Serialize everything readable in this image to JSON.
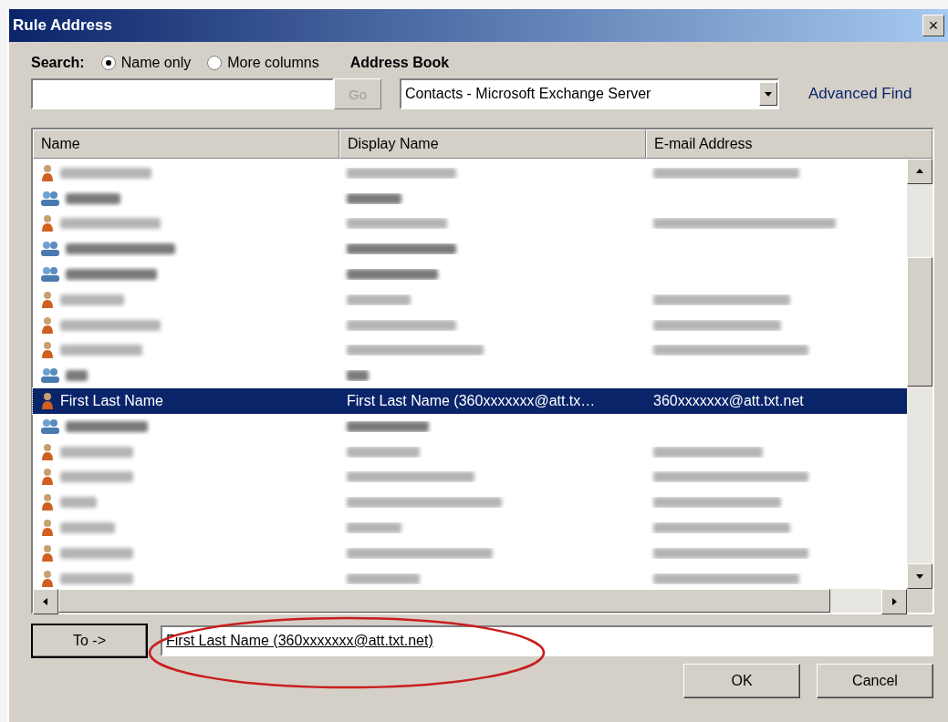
{
  "window": {
    "title": "Rule Address",
    "close": "×"
  },
  "search": {
    "label": "Search:",
    "options": [
      {
        "label": "Name only",
        "selected": true
      },
      {
        "label": "More columns",
        "selected": false
      }
    ],
    "go": "Go"
  },
  "address_book": {
    "label": "Address Book",
    "value": "Contacts - Microsoft Exchange Server"
  },
  "advanced_find": "Advanced Find",
  "table": {
    "columns": [
      "Name",
      "Display Name",
      "E-mail Address"
    ],
    "rows": [
      {
        "kind": "contact",
        "selected": false
      },
      {
        "kind": "group",
        "selected": false
      },
      {
        "kind": "contact",
        "selected": false
      },
      {
        "kind": "group",
        "selected": false
      },
      {
        "kind": "group",
        "selected": false
      },
      {
        "kind": "contact",
        "selected": false
      },
      {
        "kind": "contact",
        "selected": false
      },
      {
        "kind": "contact",
        "selected": false
      },
      {
        "kind": "group",
        "selected": false
      },
      {
        "kind": "contact",
        "selected": true,
        "cells": [
          "First Last Name",
          "First Last Name (360xxxxxxx@att.tx…",
          "360xxxxxxx@att.txt.net"
        ]
      },
      {
        "kind": "group",
        "selected": false
      },
      {
        "kind": "contact",
        "selected": false
      },
      {
        "kind": "contact",
        "selected": false
      },
      {
        "kind": "contact",
        "selected": false
      },
      {
        "kind": "contact",
        "selected": false
      },
      {
        "kind": "contact",
        "selected": false
      },
      {
        "kind": "contact",
        "selected": false
      }
    ]
  },
  "to": {
    "button": "To ->",
    "value": "First Last Name (360xxxxxxx@att.txt.net)"
  },
  "buttons": [
    "OK",
    "Cancel"
  ]
}
